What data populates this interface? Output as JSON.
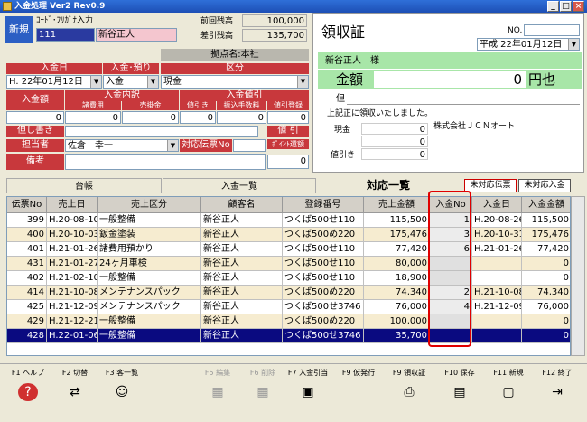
{
  "window": {
    "title": "入金処理 Ver2 Rev0.9",
    "min": "_",
    "max": "□",
    "close": "×"
  },
  "top": {
    "mode": "新規",
    "search_label": "ｺｰﾄﾞ･ﾌﾘｶﾞﾅ入力",
    "customer_code": "111",
    "customer_name": "新谷正人",
    "prev_balance_label": "前回残高",
    "prev_balance": "100,000",
    "diff_balance_label": "差引残高",
    "diff_balance": "135,700",
    "branch": "拠点名:本社"
  },
  "entry": {
    "date_label": "入金日",
    "date_value": "H. 22年01月12日",
    "type_label": "入金･預り",
    "type_value": "入金",
    "cat_label": "区分",
    "cat_value": "現金",
    "amount_label": "入金額",
    "amount_value": "0",
    "breakdown_label": "入金内訳",
    "misc_label": "諸費用",
    "misc_value": "0",
    "sales_label": "売掛金",
    "sales_value": "0",
    "discount_label": "入金値引",
    "disc1_label": "値引き",
    "disc1_value": "0",
    "fee_label": "振込手数料",
    "fee_value": "0",
    "disc_reg_label": "値引登録",
    "disc_reg_value": "0",
    "note_label": "但し書き",
    "note_btn": "値 引",
    "staff_label": "担当者",
    "staff_value": "佐倉　幸一",
    "slip_label": "対応伝票No",
    "point_label": "ﾎﾟｲﾝﾄ還額",
    "point_value": "0",
    "remarks_label": "備考"
  },
  "receipt": {
    "title": "領収証",
    "no_label": "NO.",
    "date": "平成 22年01月12日",
    "addressee": "新谷正人　様",
    "amount_label": "金額",
    "amount": "0",
    "amount_unit": "円也",
    "tadashi": "但",
    "received_text": "上記正に領収いたしました。",
    "company": "株式会社ＪＣＮオート",
    "cash_label": "現金",
    "cash": "0",
    "blank_value": "0",
    "discount_label": "値引き",
    "discount": "0"
  },
  "tabs": {
    "ledger": "台帳",
    "list": "入金一覧",
    "active": "対応一覧",
    "unmatched_slip": "未対応伝票",
    "unmatched_payment": "未対応入金"
  },
  "grid": {
    "headers": [
      "伝票No",
      "売上日",
      "売上区分",
      "顧客名",
      "登録番号",
      "売上金額",
      "入金No",
      "入金日",
      "入金金額"
    ],
    "rows": [
      [
        "399",
        "H.20-08-10",
        "一般整備",
        "新谷正人",
        "つくば500せ110",
        "115,500",
        "1",
        "H.20-08-26",
        "115,500"
      ],
      [
        "400",
        "H.20-10-03",
        "鈑金塗装",
        "新谷正人",
        "つくば500め220",
        "175,476",
        "3",
        "H.20-10-31",
        "175,476"
      ],
      [
        "401",
        "H.21-01-26",
        "諸費用預かり",
        "新谷正人",
        "つくば500せ110",
        "77,420",
        "6",
        "H.21-01-26",
        "77,420"
      ],
      [
        "431",
        "H.21-01-27",
        "24ヶ月車検",
        "新谷正人",
        "つくば500せ110",
        "80,000",
        "",
        "",
        "0"
      ],
      [
        "402",
        "H.21-02-10",
        "一般整備",
        "新谷正人",
        "つくば500せ110",
        "18,900",
        "",
        "",
        "0"
      ],
      [
        "414",
        "H.21-10-08",
        "メンテナンスパック",
        "新谷正人",
        "つくば500め220",
        "74,340",
        "2",
        "H.21-10-08",
        "74,340"
      ],
      [
        "425",
        "H.21-12-09",
        "メンテナンスパック",
        "新谷正人",
        "つくば500せ3746",
        "76,000",
        "4",
        "H.21-12-09",
        "76,000"
      ],
      [
        "429",
        "H.21-12-21",
        "一般整備",
        "新谷正人",
        "つくば500め220",
        "100,000",
        "",
        "",
        "0"
      ],
      [
        "428",
        "H.22-01-06",
        "一般整備",
        "新谷正人",
        "つくば500せ3746",
        "35,700",
        "",
        "",
        "0"
      ]
    ]
  },
  "fkeys": [
    {
      "label": "F1 ヘルプ",
      "icon": "?",
      "enabled": true
    },
    {
      "label": "F2 切替",
      "icon": "⇄",
      "enabled": true
    },
    {
      "label": "F3 客一覧",
      "icon": "☺",
      "enabled": true
    },
    {
      "label": "F5 編集",
      "icon": "▦",
      "enabled": false
    },
    {
      "label": "F6 削除",
      "icon": "▦",
      "enabled": false
    },
    {
      "label": "F7 入金引当",
      "icon": "▣",
      "enabled": true
    },
    {
      "label": "F9 仮発行",
      "icon": "",
      "enabled": true
    },
    {
      "label": "F9 領収証",
      "icon": "⎙",
      "enabled": true
    },
    {
      "label": "F10 保存",
      "icon": "▤",
      "enabled": true
    },
    {
      "label": "F11 新規",
      "icon": "▢",
      "enabled": true
    },
    {
      "label": "F12 終了",
      "icon": "⇥",
      "enabled": true
    }
  ],
  "colors": {
    "accent_red": "#c8383c",
    "selected_row": "#0a0a80",
    "highlight_box": "#e00000",
    "receipt_green": "#a8e6a8"
  }
}
